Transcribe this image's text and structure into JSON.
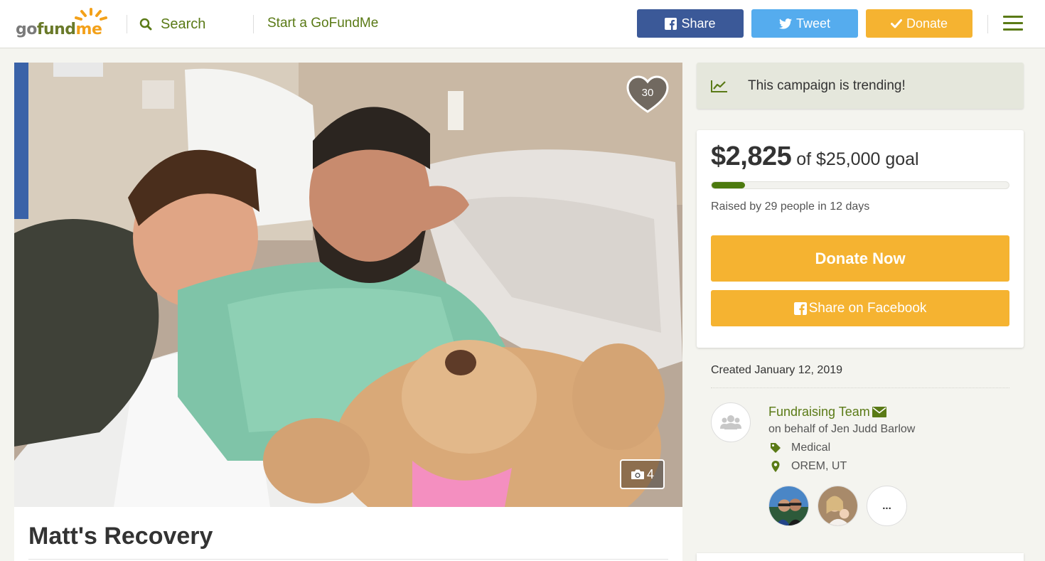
{
  "header": {
    "logo": {
      "go": "go",
      "fund": "fund",
      "me": "me"
    },
    "search_label": "Search",
    "start_label": "Start a GoFundMe",
    "share_label": "Share",
    "tweet_label": "Tweet",
    "donate_label": "Donate"
  },
  "photo": {
    "heart_count": "30",
    "photo_count": "4"
  },
  "campaign": {
    "title": "Matt's Recovery"
  },
  "sidebar": {
    "trending_text": "This campaign is trending!",
    "raised_amount": "$2,825",
    "goal_text": "of $25,000 goal",
    "progress_fraction": 0.113,
    "raised_by": "Raised by 29 people in 12 days",
    "donate_now_label": "Donate Now",
    "share_facebook_label": "Share on Facebook",
    "created": "Created January 12, 2019",
    "team_name": "Fundraising Team",
    "behalf": "on behalf of Jen Judd Barlow",
    "category": "Medical",
    "location": "OREM, UT",
    "more_label": "..."
  },
  "colors": {
    "brand_green": "#5a7a16",
    "donate_yellow": "#f5b331",
    "facebook_blue": "#3b5998",
    "twitter_blue": "#55acee",
    "progress_green": "#4c7a0e"
  }
}
